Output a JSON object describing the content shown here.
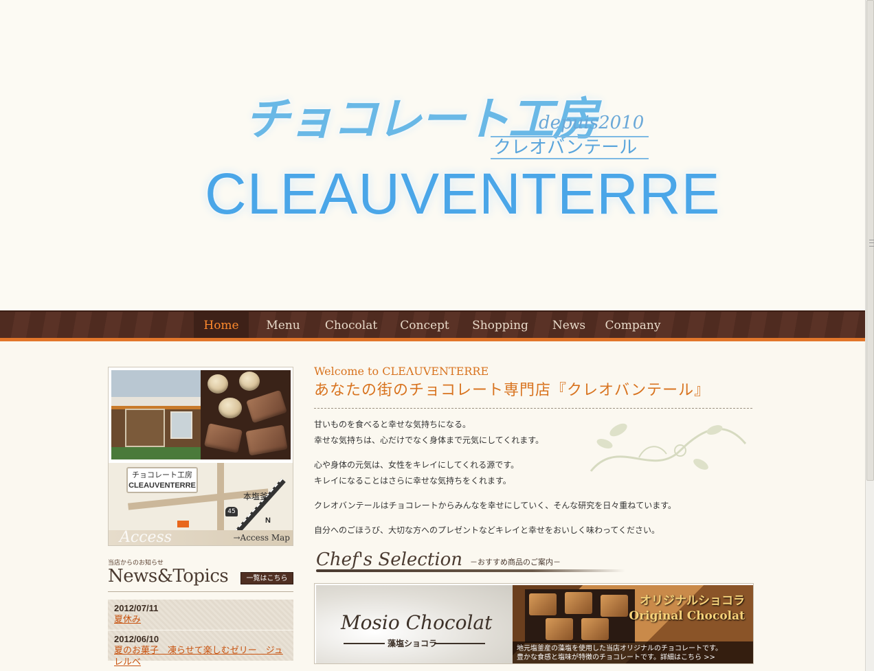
{
  "header": {
    "logo_jp": "チョコレート工房",
    "logo_depuis": "depuis2010",
    "logo_katakana": "クレオバンテール",
    "logo_roman": "CLEAUVENTERRE"
  },
  "nav": {
    "items": [
      {
        "label": "Home",
        "active": true
      },
      {
        "label": "Menu",
        "active": false
      },
      {
        "label": "Chocolat",
        "active": false
      },
      {
        "label": "Concept",
        "active": false
      },
      {
        "label": "Shopping",
        "active": false
      },
      {
        "label": "News",
        "active": false
      },
      {
        "label": "Company",
        "active": false
      }
    ]
  },
  "sidebar": {
    "map": {
      "label_jp": "チョコレート工房",
      "label_en": "CLEAUVENTERRE",
      "station": "本塩釜",
      "route": "45",
      "north": "N",
      "script": "Access",
      "link": "→Access Map"
    },
    "news": {
      "subtitle": "当店からのお知らせ",
      "title": "News&Topics",
      "all_label": "一覧はこちら",
      "items": [
        {
          "date": "2012/07/11",
          "title": "夏休み"
        },
        {
          "date": "2012/06/10",
          "title": "夏のお菓子　凍らせて楽しむゼリー　ジュレルベ"
        }
      ]
    }
  },
  "main": {
    "welcome": "Welcome to CLEΛUVENTERRE",
    "tagline": "あなたの街のチョコレート専門店『クレオバンテール』",
    "paragraphs": [
      [
        "甘いものを食べると幸せな気持ちになる。",
        "幸せな気持ちは、心だけでなく身体まで元気にしてくれます。"
      ],
      [
        "心や身体の元気は、女性をキレイにしてくれる源です。",
        "キレイになることはさらに幸せな気持ちをくれます。"
      ],
      [
        "クレオバンテールはチョコレートからみんなを幸せにしていく、そんな研究を日々重ねています。"
      ],
      [
        "自分へのごほうび、大切な方へのプレゼントなどキレイと幸せをおいしく味わってください。"
      ]
    ],
    "chef": {
      "title": "Chef's Selection",
      "subtitle": "－おすすめ商品のご案内－"
    },
    "banner": {
      "left_script": "Mosio Chocolat",
      "left_jp": "藻塩ショコラ",
      "right_title_jp": "オリジナルショコラ",
      "right_title_en": "Original Chocolat",
      "right_caption_1": "地元塩釜産の藻塩を使用した当店オリジナルのチョコレートです。",
      "right_caption_2": "豊かな食感と塩味が特徴のチョコレートです。詳細はこちら >>"
    }
  },
  "colors": {
    "accent": "#d8731f",
    "nav_bg": "#4f2b20",
    "nav_active": "#ff8a2d",
    "logo_blue": "#4aa6e8"
  }
}
